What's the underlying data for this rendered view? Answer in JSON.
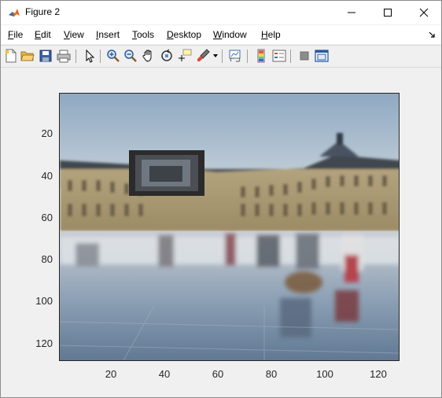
{
  "window": {
    "title": "Figure 2"
  },
  "menu": {
    "items": [
      "File",
      "Edit",
      "View",
      "Insert",
      "Tools",
      "Desktop",
      "Window",
      "Help"
    ],
    "overflow_icon": "dock-arrow-icon"
  },
  "toolbar": {
    "buttons": [
      "new-figure",
      "open-file",
      "save",
      "print",
      "edit-plot-cursor",
      "zoom-in",
      "zoom-out",
      "pan",
      "rotate-3d",
      "data-cursor",
      "brush",
      "link-plot",
      "insert-colorbar",
      "insert-legend",
      "hide-plot-tools",
      "show-plot-tools"
    ]
  },
  "axes": {
    "yticks": [
      "20",
      "40",
      "60",
      "80",
      "100",
      "120"
    ],
    "xticks": [
      "20",
      "40",
      "60",
      "80",
      "100",
      "120"
    ],
    "xlim": [
      0.5,
      128.5
    ],
    "ylim": [
      0.5,
      128.5
    ],
    "image_description_icon": "blurred-photo-plaza-fountain-with-building",
    "colors": {
      "sky": "#9fb7cc",
      "building": "#b9a678",
      "water": "#a8b6c4",
      "frame": "#262626"
    }
  }
}
